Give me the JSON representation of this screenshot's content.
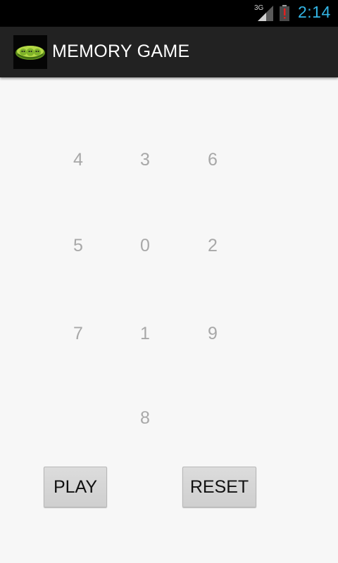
{
  "status_bar": {
    "network": "3G",
    "time": "2:14",
    "icons": [
      "signal-icon",
      "battery-alert-icon"
    ],
    "time_color": "#33b5e5"
  },
  "action_bar": {
    "title": "MEMORY GAME",
    "icon": "peapod-app-icon"
  },
  "grid": {
    "rows": [
      [
        "4",
        "3",
        "6"
      ],
      [
        "5",
        "0",
        "2"
      ],
      [
        "7",
        "1",
        "9"
      ],
      [
        "",
        "8",
        ""
      ]
    ],
    "text_color": "#a8a8a8"
  },
  "buttons": {
    "play": "PLAY",
    "reset": "RESET"
  }
}
